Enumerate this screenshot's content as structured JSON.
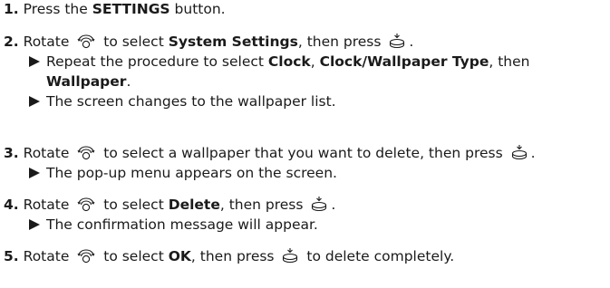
{
  "steps": [
    {
      "num": "1.",
      "t1": "Press the ",
      "b1": "SETTINGS",
      "t2": " button."
    },
    {
      "num": "2.",
      "t1": "Rotate ",
      "t2": " to select ",
      "b1": "System Settings",
      "t3": ", then press ",
      "t4": ".",
      "sub1": {
        "t1": "Repeat the procedure to select ",
        "b1": "Clock",
        "t2": ", ",
        "b2": "Clock/Wallpaper Type",
        "t3": ", then",
        "b3": "Wallpaper",
        "t4": "."
      },
      "sub2": "The screen changes to the wallpaper list."
    },
    {
      "num": "3.",
      "t1": "Rotate ",
      "t2": " to select a wallpaper that you want to delete, then press ",
      "t3": ".",
      "sub1": "The pop-up menu appears on the screen."
    },
    {
      "num": "4.",
      "t1": "Rotate ",
      "t2": " to select ",
      "b1": "Delete",
      "t3": ", then press ",
      "t4": ".",
      "sub1": "The confirmation message will appear."
    },
    {
      "num": "5.",
      "t1": "Rotate ",
      "t2": " to select ",
      "b1": "OK",
      "t3": ", then press ",
      "t4": " to delete completely."
    }
  ],
  "icons": {
    "knob": "interface-dial-rotate-icon",
    "press": "interface-dial-press-icon",
    "bullet": "triangle-bullet-icon"
  }
}
